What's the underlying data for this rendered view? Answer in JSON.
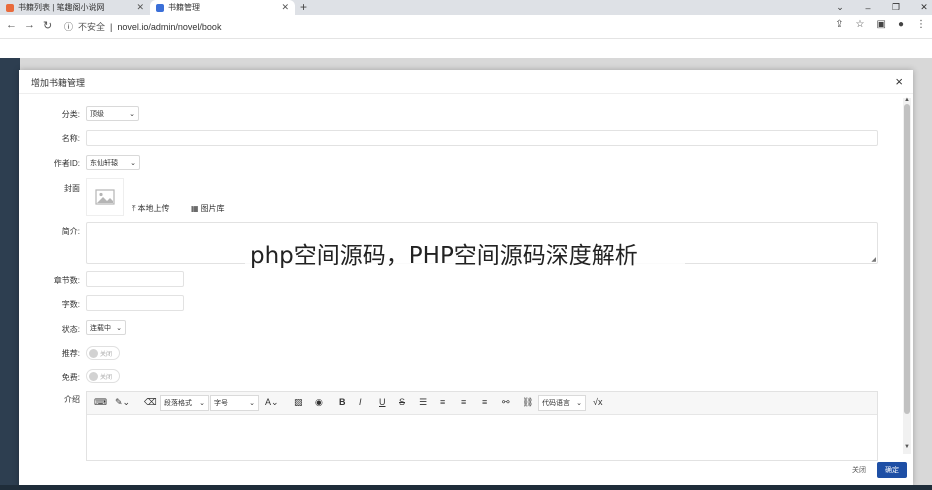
{
  "browser": {
    "tabs": [
      {
        "label": "书籍列表 | 笔趣阁小说网",
        "active": false,
        "favicon_color": "#e96b3c"
      },
      {
        "label": "书籍管理",
        "active": true,
        "favicon_color": "#3b6fd8"
      }
    ],
    "new_tab": "+",
    "address": {
      "security_label": "不安全",
      "url": "novel.io/admin/novel/book"
    },
    "icons": [
      "back-icon",
      "forward-icon",
      "reload-icon",
      "info-icon",
      "share-icon",
      "star-icon",
      "sidepanel-icon",
      "profile-icon",
      "menu-icon"
    ]
  },
  "modal": {
    "title": "增加书籍管理",
    "close": "×",
    "fields": {
      "category": {
        "label": "分类:",
        "value": "顶级"
      },
      "name": {
        "label": "名称:",
        "value": ""
      },
      "author": {
        "label": "作者ID:",
        "value": "东仙轩辕"
      },
      "cover": {
        "label": "封面",
        "upload_label": "本地上传",
        "gallery_label": "图片库"
      },
      "intro": {
        "label": "简介:",
        "value": ""
      },
      "chapters": {
        "label": "章节数:",
        "value": ""
      },
      "words": {
        "label": "字数:",
        "value": ""
      },
      "status": {
        "label": "状态:",
        "value": "连载中"
      },
      "recommend": {
        "label": "推荐:",
        "toggle": "关闭"
      },
      "free": {
        "label": "免费:",
        "toggle": "关闭"
      },
      "content": {
        "label": "介绍"
      }
    },
    "editor": {
      "paragraph_select": "段落格式",
      "font_select": "字号",
      "code_select": "代码语言"
    },
    "buttons": {
      "close": "关闭",
      "ok": "确定"
    }
  },
  "watermark": "php空间源码，PHP空间源码深度解析"
}
